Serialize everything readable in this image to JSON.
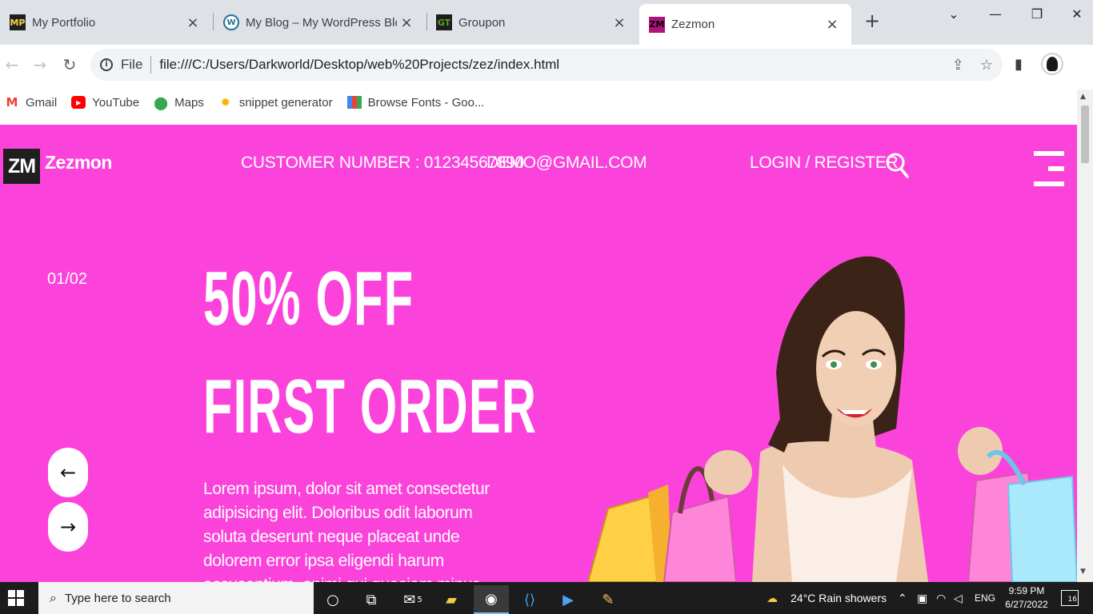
{
  "browser": {
    "tabs": [
      {
        "title": "My Portfolio",
        "favicon": "MP",
        "active": false
      },
      {
        "title": "My Blog – My WordPress Blog",
        "favicon": "W",
        "active": false
      },
      {
        "title": "Groupon",
        "favicon": "GT",
        "active": false
      },
      {
        "title": "Zezmon",
        "favicon": "ZM",
        "active": true
      }
    ],
    "tab_close_glyph": "×",
    "new_tab_glyph": "+",
    "window_controls": [
      "⌄",
      "—",
      "❐",
      "✕"
    ],
    "address": {
      "scheme_label": "File",
      "url": "file:///C:/Users/Darkworld/Desktop/web%20Projects/zez/index.html"
    },
    "bookmarks": [
      {
        "label": "Gmail",
        "icon": "gmail-icon"
      },
      {
        "label": "YouTube",
        "icon": "youtube-icon"
      },
      {
        "label": "Maps",
        "icon": "maps-icon"
      },
      {
        "label": "snippet generator",
        "icon": "snippet-icon"
      },
      {
        "label": "Browse Fonts - Goo...",
        "icon": "google-fonts-icon"
      }
    ]
  },
  "site": {
    "logo_mark": "ZM",
    "logo_name": "Zezmon",
    "customer_number": "CUSTOMER NUMBER : 01234567890",
    "email": "DEMO@GMAIL.COM",
    "login_register": "LOGIN / REGISTER",
    "hero_bg_color": "#fb43db",
    "slide_counter": "01/02",
    "headline_1": "50% OFF",
    "headline_2": "FIRST ORDER",
    "body_text": "Lorem ipsum, dolor sit amet consectetur adipisicing elit. Doloribus odit laborum soluta deserunt neque placeat unde dolorem error ipsa eligendi harum accusantium, animi qui quasiam minus cupiditate aes",
    "prev_glyph": "←",
    "next_glyph": "→"
  },
  "taskbar": {
    "search_placeholder": "Type here to search",
    "mail_badge": "5",
    "weather": "24°C  Rain showers",
    "language": "ENG",
    "time": "9:59 PM",
    "date": "6/27/2022",
    "notification_count": "16"
  }
}
